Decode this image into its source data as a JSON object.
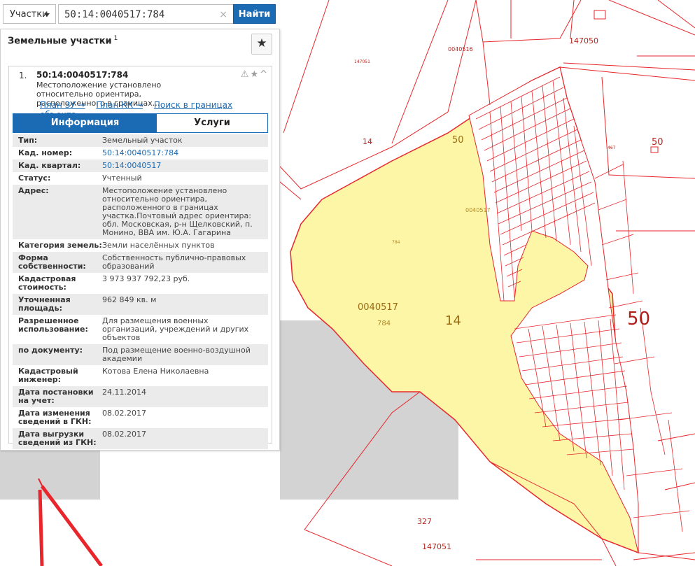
{
  "search": {
    "type_label": "Участки",
    "query": "50:14:0040517:784",
    "clear_glyph": "×",
    "button_label": "Найти"
  },
  "panel": {
    "title": "Земельные участки",
    "count": "1",
    "star_glyph": "★"
  },
  "result": {
    "index": "1.",
    "cad_number": "50:14:0040517:784",
    "description": "Местоположение установлено относительно ориентира, расположенного в границах...",
    "links": [
      "План ЗУ →",
      "План КК →",
      "Поиск в границах объекта →"
    ],
    "tabs": [
      "Информация",
      "Услуги"
    ]
  },
  "info_rows": [
    {
      "label": "Тип:",
      "value": "Земельный участок"
    },
    {
      "label": "Кад. номер:",
      "value": "50:14:0040517:784"
    },
    {
      "label": "Кад. квартал:",
      "value": "50:14:0040517"
    },
    {
      "label": "Статус:",
      "value": "Учтенный"
    },
    {
      "label": "Адрес:",
      "value": "Местоположение установлено относительно ориентира, расположенного в границах участка.Почтовый адрес ориентира: обл. Московская, р-н Щелковский, п. Монино, ВВА им. Ю.А. Гагарина"
    },
    {
      "label": "Категория земель:",
      "value": "Земли населённых пунктов"
    },
    {
      "label": "Форма собственности:",
      "value": "Собственность публично-правовых образований"
    },
    {
      "label": "Кадастровая стоимость:",
      "value": "3 973 937 792,23 руб."
    },
    {
      "label": "Уточненная площадь:",
      "value": "962 849 кв. м"
    },
    {
      "label": "Разрешенное использование:",
      "value": "Для размещения военных организаций, учреждений и других объектов"
    },
    {
      "label": "по документу:",
      "value": "Под размещение военно-воздушной академии"
    },
    {
      "label": "Кадастровый инженер:",
      "value": "Котова Елена Николаевна"
    },
    {
      "label": "Дата постановки на учет:",
      "value": "24.11.2014"
    },
    {
      "label": "Дата изменения сведений в ГКН:",
      "value": "08.02.2017"
    },
    {
      "label": "Дата выгрузки сведений из ГКН:",
      "value": "08.02.2017"
    }
  ],
  "map_labels": {
    "l147050": "147050",
    "l0040516": "0040516",
    "l14_top": "14",
    "l50_top": "50",
    "l0040517_small": "0040517",
    "l784_small": "784",
    "l0040517": "0040517",
    "l784": "784",
    "l14_mid": "14",
    "l50_big": "50",
    "l50_right": "50",
    "l327": "327",
    "l147051": "147051",
    "l147051_small": "147051",
    "l467": "467"
  },
  "colors": {
    "parcel_line": "#e8262b",
    "parcel_fill": "#fdf6a7",
    "accent": "#1b6ab4"
  }
}
